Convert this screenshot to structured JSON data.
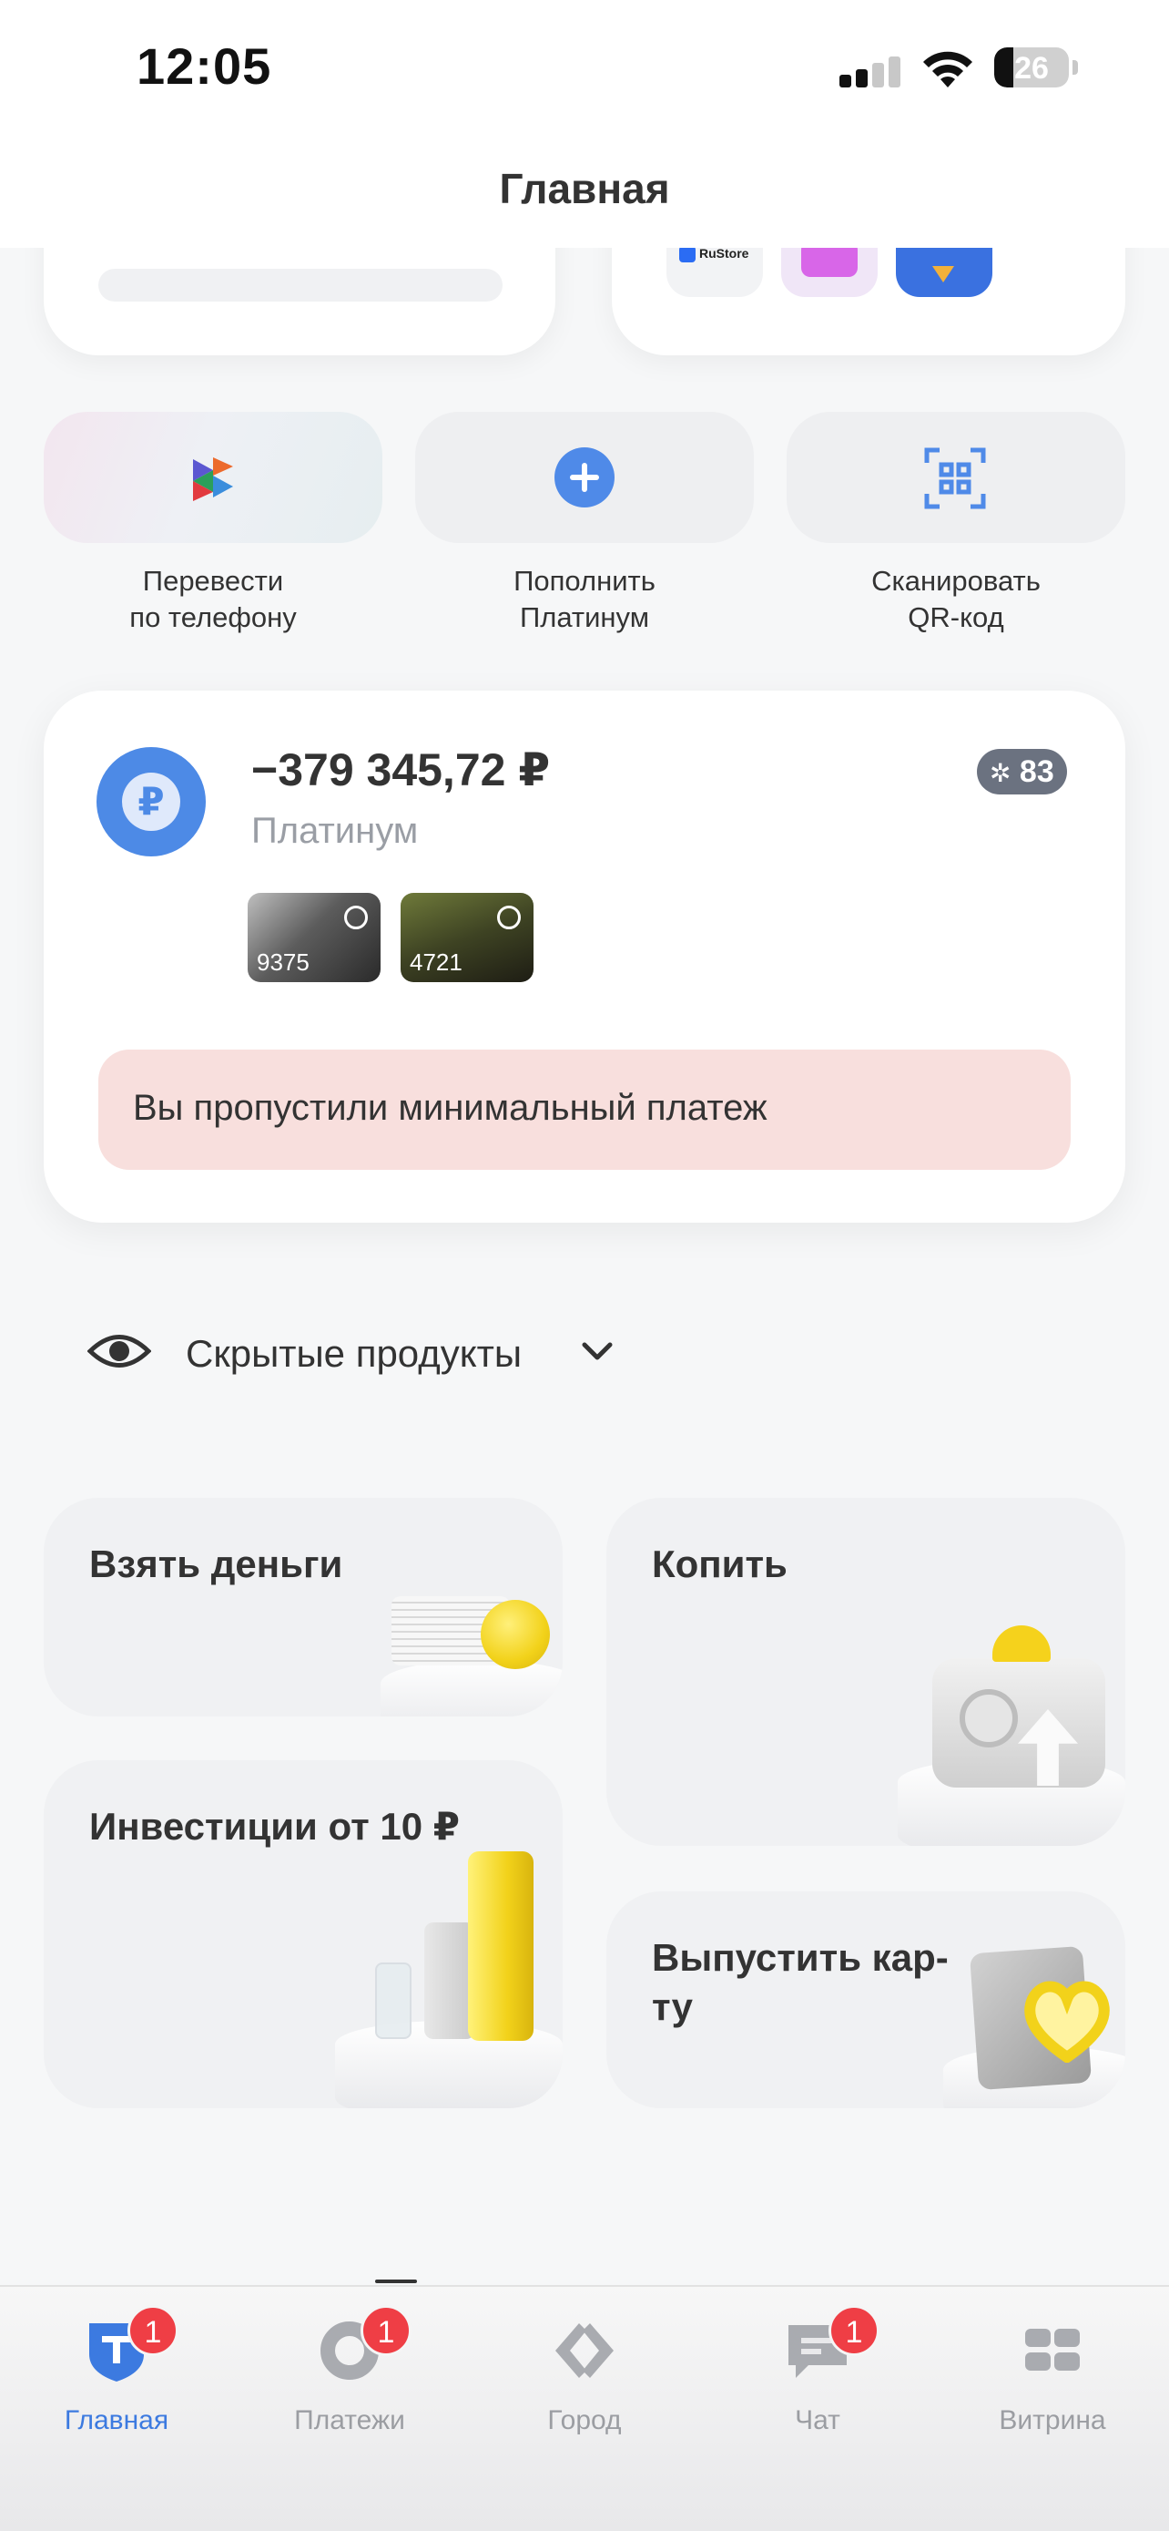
{
  "status_bar": {
    "time": "12:05",
    "battery": "26"
  },
  "header": {
    "title": "Главная"
  },
  "top_apps": {
    "rustore_label": "RuStore"
  },
  "quick_actions": [
    {
      "label_line1": "Перевести",
      "label_line2": "по телефону",
      "icon": "sbp-transfer-icon"
    },
    {
      "label_line1": "Пополнить",
      "label_line2": "Платинум",
      "icon": "plus-circle-icon"
    },
    {
      "label_line1": "Сканировать",
      "label_line2": "QR-код",
      "icon": "qr-scan-icon"
    }
  ],
  "account": {
    "balance": "−379 345,72 ₽",
    "name": "Платинум",
    "currency_symbol": "₽",
    "cashback_count": "83",
    "cards": [
      {
        "last4": "9375"
      },
      {
        "last4": "4721"
      }
    ],
    "alert": "Вы пропустили минимальный платеж"
  },
  "hidden_products": {
    "label": "Скрытые продукты"
  },
  "tiles": {
    "take_money": "Взять деньги",
    "save": "Копить",
    "invest": "Инвестиции от 10 ₽",
    "issue_card_line1": "Выпустить кар-",
    "issue_card_line2": "ту"
  },
  "tabbar": {
    "tabs": [
      {
        "label": "Главная",
        "badge": "1",
        "active": true
      },
      {
        "label": "Платежи",
        "badge": "1"
      },
      {
        "label": "Город"
      },
      {
        "label": "Чат",
        "badge": "1"
      },
      {
        "label": "Витрина"
      }
    ]
  },
  "colors": {
    "accent": "#3c7ae0",
    "alert_bg": "#f8dfdd",
    "badge": "#ef3e45"
  }
}
